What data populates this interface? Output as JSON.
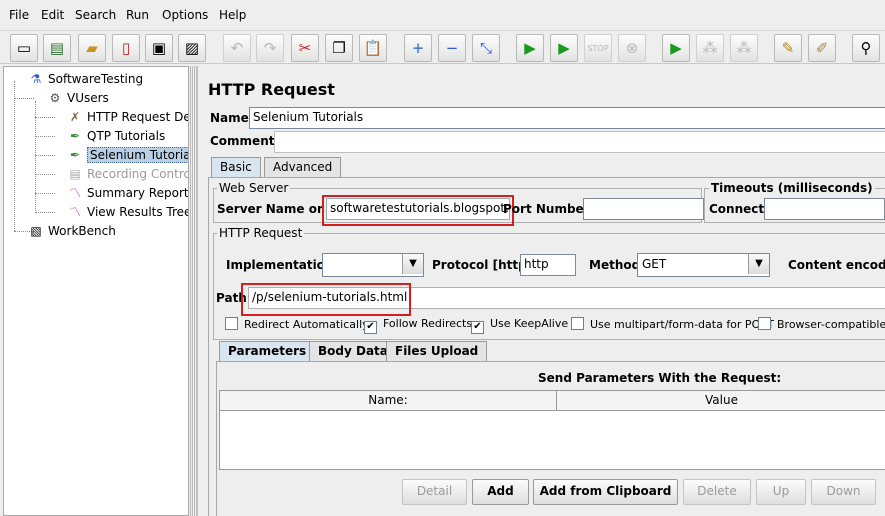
{
  "menu": [
    "File",
    "Edit",
    "Search",
    "Run",
    "Options",
    "Help"
  ],
  "toolbar_icons": [
    "new-icon",
    "templates-icon",
    "open-icon",
    "close-icon",
    "save-icon",
    "save-as-icon",
    "undo-icon",
    "redo-icon",
    "cut-icon",
    "copy-icon",
    "paste-icon",
    "expand-icon",
    "collapse-icon",
    "toggle-icon",
    "start-icon",
    "start-no-pause-icon",
    "stop-icon",
    "shutdown-icon",
    "remote-start-icon",
    "remote-stop-icon",
    "remote-shutdown-icon",
    "clear-icon",
    "clear-all-icon",
    "search-icon"
  ],
  "tree": {
    "root": "SoftwareTesting",
    "thread_group": "VUsers",
    "items": [
      "HTTP Request De",
      "QTP Tutorials",
      "Selenium Tutorial",
      "Recording Contro",
      "Summary Report",
      "View Results Tree"
    ],
    "workbench": "WorkBench"
  },
  "panel": {
    "title": "HTTP Request",
    "name_label": "Name:",
    "name_value": "Selenium Tutorials",
    "comments_label": "Comments:",
    "tabs": [
      "Basic",
      "Advanced"
    ],
    "web_server": {
      "title": "Web Server",
      "server_label": "Server Name or IP:",
      "server_value": "softwaretestutorials.blogspot.in",
      "port_label": "Port Number:",
      "port_value": ""
    },
    "timeouts": {
      "title": "Timeouts (milliseconds)",
      "connect_label": "Connect:"
    },
    "http_request": {
      "title": "HTTP Request",
      "implementation_label": "Implementation:",
      "implementation_value": "",
      "protocol_label": "Protocol [http]:",
      "protocol_value": "http",
      "method_label": "Method:",
      "method_value": "GET",
      "content_encoding_label": "Content encoding",
      "path_label": "Path:",
      "path_value": "/p/selenium-tutorials.html"
    },
    "checkboxes": [
      {
        "label": "Redirect Automatically",
        "checked": false
      },
      {
        "label": "Follow Redirects",
        "checked": true
      },
      {
        "label": "Use KeepAlive",
        "checked": true
      },
      {
        "label": "Use multipart/form-data for POST",
        "checked": false
      },
      {
        "label": "Browser-compatible hea",
        "checked": false
      }
    ],
    "sub_tabs": [
      "Parameters",
      "Body Data",
      "Files Upload"
    ],
    "params_title": "Send Parameters With the Request:",
    "columns": [
      "Name:",
      "Value"
    ],
    "buttons": [
      "Detail",
      "Add",
      "Add from Clipboard",
      "Delete",
      "Up",
      "Down"
    ]
  }
}
